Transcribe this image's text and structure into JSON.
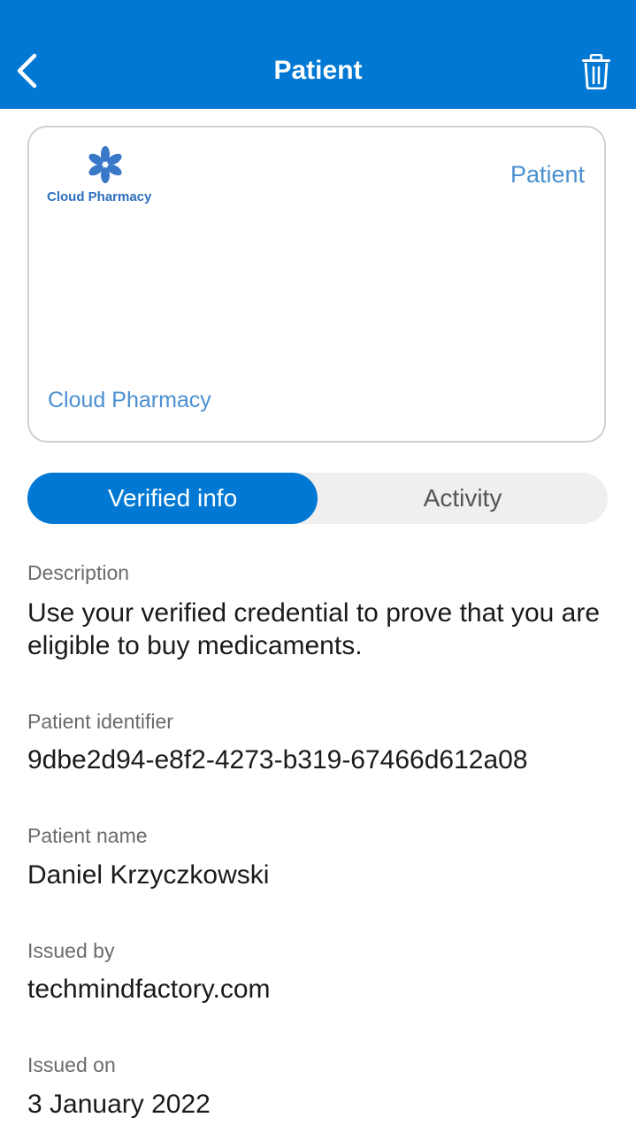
{
  "header": {
    "title": "Patient",
    "background": "#0078d4",
    "back_icon": "chevron-left-icon",
    "delete_icon": "trash-icon"
  },
  "card": {
    "logo_text": "Cloud Pharmacy",
    "type": "Patient",
    "issuer": "Cloud Pharmacy",
    "accent_color": "#4a8fd0"
  },
  "tabs": [
    {
      "label": "Verified info",
      "active": true
    },
    {
      "label": "Activity",
      "active": false
    }
  ],
  "fields": {
    "description": {
      "label": "Description",
      "value": "Use your verified credential to prove that you are eligible to buy medicaments."
    },
    "patient_identifier": {
      "label": "Patient identifier",
      "value": "9dbe2d94-e8f2-4273-b319-67466d612a08"
    },
    "patient_name": {
      "label": "Patient name",
      "value": "Daniel Krzyczkowski"
    },
    "issued_by": {
      "label": "Issued by",
      "value": "techmindfactory.com"
    },
    "issued_on": {
      "label": "Issued on",
      "value": "3 January 2022"
    }
  }
}
